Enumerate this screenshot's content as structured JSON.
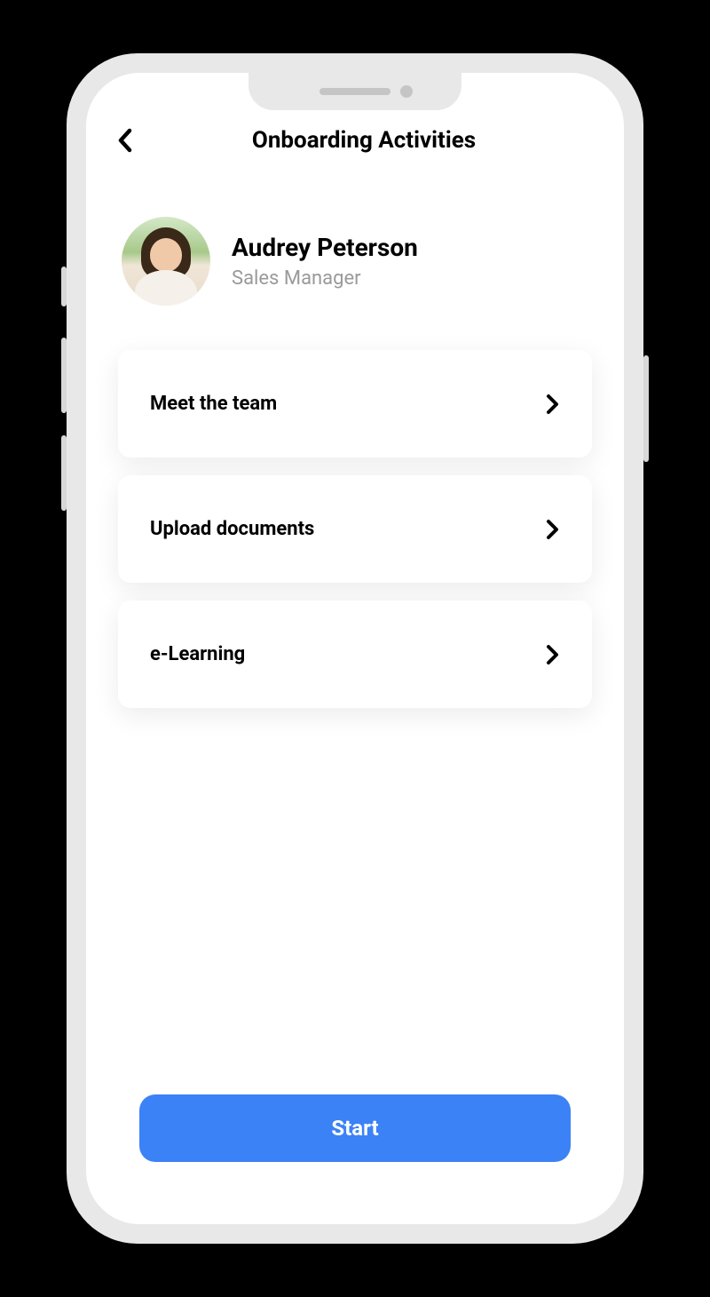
{
  "header": {
    "title": "Onboarding Activities"
  },
  "profile": {
    "name": "Audrey Peterson",
    "role": "Sales Manager"
  },
  "activities": [
    {
      "title": "Meet the team"
    },
    {
      "title": "Upload documents"
    },
    {
      "title": "e-Learning"
    }
  ],
  "footer": {
    "start_label": "Start"
  },
  "colors": {
    "primary": "#3b82f6"
  }
}
